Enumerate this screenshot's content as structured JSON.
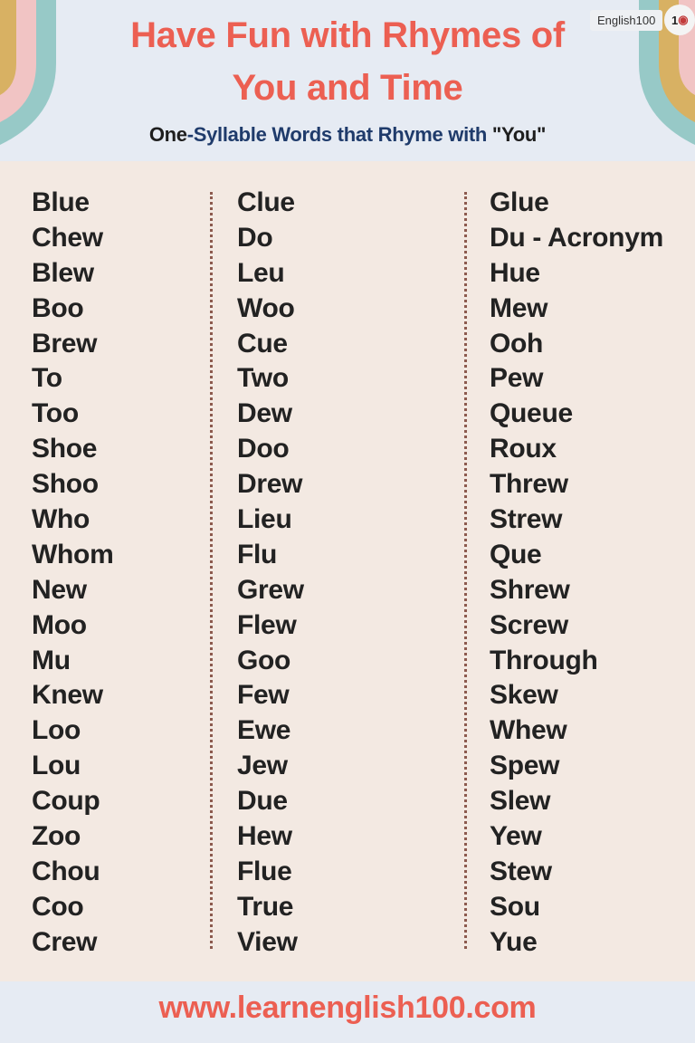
{
  "header": {
    "title_line1": "Have Fun with Rhymes of",
    "title_line2": "You and Time",
    "subtitle_part1": "One",
    "subtitle_part2": "-Syllable Words that Rhyme with ",
    "subtitle_part3": "\"You\"",
    "logo_text": "English100",
    "logo_badge": "1",
    "logo_badge_icon": "globe-flag-icon"
  },
  "colors": {
    "title": "#ec5f52",
    "subtitle": "#1f3b6b",
    "text": "#222222",
    "header_bg": "#e6ebf3",
    "panel_bg": "#f3e9e2",
    "divider": "#8c5a4e",
    "arc_gold": "#d8b163",
    "arc_pink": "#f1c4c4",
    "arc_teal": "#97c9c7"
  },
  "columns": [
    [
      "Blue",
      "Chew",
      "Blew",
      "Boo",
      "Brew",
      "To",
      "Too",
      "Shoe",
      "Shoo",
      "Who",
      "Whom",
      "New",
      "Moo",
      "Mu",
      "Knew",
      "Loo",
      "Lou",
      "Coup",
      "Zoo",
      "Chou",
      "Coo",
      "Crew"
    ],
    [
      "Clue",
      "Do",
      "Leu",
      "Woo",
      "Cue",
      "Two",
      "Dew",
      "Doo",
      "Drew",
      "Lieu",
      "Flu",
      "Grew",
      "Flew",
      "Goo",
      "Few",
      "Ewe",
      "Jew",
      "Due",
      "Hew",
      "Flue",
      "True",
      "View"
    ],
    [
      "Glue",
      "Du - Acronym",
      "Hue",
      "Mew",
      "Ooh",
      "Pew",
      "Queue",
      "Roux",
      "Threw",
      "Strew",
      "Que",
      "Shrew",
      "Screw",
      "Through",
      "Skew",
      "Whew",
      "Spew",
      "Slew",
      "Yew",
      "Stew",
      "Sou",
      "Yue"
    ]
  ],
  "footer": {
    "url": "www.learnenglish100.com"
  }
}
